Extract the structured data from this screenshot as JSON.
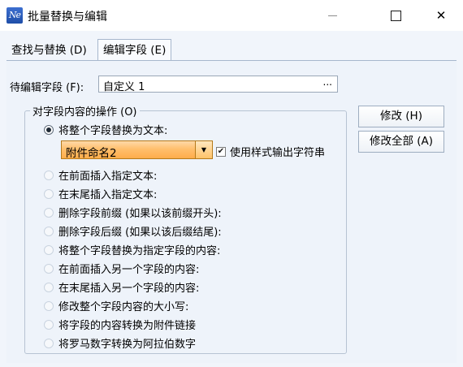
{
  "window": {
    "title": "批量替换与编辑",
    "icon_text": "Ne",
    "close_glyph": "✕"
  },
  "tabs": [
    {
      "label": "查找与替换 (D)"
    },
    {
      "label": "编辑字段 (E)",
      "active": true
    }
  ],
  "field": {
    "label": "待编辑字段 (F):",
    "value": "自定义 1",
    "browse_label": "..."
  },
  "operations": {
    "legend": "对字段内容的操作 (O)",
    "options": [
      {
        "label": "将整个字段替换为文本:",
        "checked": true
      },
      {
        "label": "在前面插入指定文本:"
      },
      {
        "label": "在末尾插入指定文本:"
      },
      {
        "label": "删除字段前缀 (如果以该前缀开头):"
      },
      {
        "label": "删除字段后缀 (如果以该后缀结尾):"
      },
      {
        "label": "将整个字段替换为指定字段的内容:"
      },
      {
        "label": "在前面插入另一个字段的内容:"
      },
      {
        "label": "在末尾插入另一个字段的内容:"
      },
      {
        "label": "修改整个字段内容的大小写:"
      },
      {
        "label": "将字段的内容转换为附件链接"
      },
      {
        "label": "将罗马数字转换为阿拉伯数字"
      }
    ],
    "replace_value": "附件命名2",
    "combo_arrow": "▼",
    "style_checkbox": {
      "label": "使用样式输出字符串",
      "checked": true,
      "mark": "✔"
    }
  },
  "buttons": {
    "modify": "修改 (H)",
    "modify_all": "修改全部 (A)"
  },
  "colors": {
    "accent_combo": "#ffbf6d",
    "dialog_bg": "#f1f5fb"
  }
}
